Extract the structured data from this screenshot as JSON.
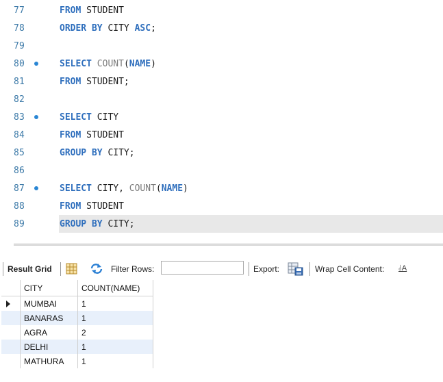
{
  "editor": {
    "lines": [
      {
        "number": "77",
        "marker": false,
        "tokens": [
          {
            "t": "kw",
            "v": "FROM "
          },
          {
            "t": "plain",
            "v": "STUDENT"
          }
        ]
      },
      {
        "number": "78",
        "marker": false,
        "tokens": [
          {
            "t": "kw",
            "v": "ORDER BY "
          },
          {
            "t": "plain",
            "v": "CITY "
          },
          {
            "t": "kw",
            "v": "ASC"
          },
          {
            "t": "plain",
            "v": ";"
          }
        ]
      },
      {
        "number": "79",
        "marker": false,
        "tokens": []
      },
      {
        "number": "80",
        "marker": true,
        "tokens": [
          {
            "t": "kw",
            "v": "SELECT "
          },
          {
            "t": "fn",
            "v": "COUNT"
          },
          {
            "t": "plain",
            "v": "("
          },
          {
            "t": "col",
            "v": "NAME"
          },
          {
            "t": "plain",
            "v": ")"
          }
        ]
      },
      {
        "number": "81",
        "marker": false,
        "tokens": [
          {
            "t": "kw",
            "v": "FROM "
          },
          {
            "t": "plain",
            "v": "STUDENT;"
          }
        ]
      },
      {
        "number": "82",
        "marker": false,
        "tokens": []
      },
      {
        "number": "83",
        "marker": true,
        "tokens": [
          {
            "t": "kw",
            "v": "SELECT "
          },
          {
            "t": "plain",
            "v": "CITY"
          }
        ]
      },
      {
        "number": "84",
        "marker": false,
        "tokens": [
          {
            "t": "kw",
            "v": "FROM "
          },
          {
            "t": "plain",
            "v": "STUDENT"
          }
        ]
      },
      {
        "number": "85",
        "marker": false,
        "tokens": [
          {
            "t": "kw",
            "v": "GROUP BY "
          },
          {
            "t": "plain",
            "v": "CITY;"
          }
        ]
      },
      {
        "number": "86",
        "marker": false,
        "tokens": []
      },
      {
        "number": "87",
        "marker": true,
        "tokens": [
          {
            "t": "kw",
            "v": "SELECT "
          },
          {
            "t": "plain",
            "v": "CITY, "
          },
          {
            "t": "fn",
            "v": "COUNT"
          },
          {
            "t": "plain",
            "v": "("
          },
          {
            "t": "col",
            "v": "NAME"
          },
          {
            "t": "plain",
            "v": ")"
          }
        ]
      },
      {
        "number": "88",
        "marker": false,
        "tokens": [
          {
            "t": "kw",
            "v": "FROM "
          },
          {
            "t": "plain",
            "v": "STUDENT"
          }
        ]
      },
      {
        "number": "89",
        "marker": false,
        "current": true,
        "tokens": [
          {
            "t": "kw",
            "v": "GROUP BY "
          },
          {
            "t": "plain",
            "v": "CITY;"
          }
        ]
      }
    ]
  },
  "toolbar": {
    "result_grid_label": "Result Grid",
    "filter_rows_label": "Filter Rows:",
    "filter_rows_value": "",
    "export_label": "Export:",
    "wrap_label": "Wrap Cell Content:",
    "wrap_icon_text": "⫰A"
  },
  "grid": {
    "columns": [
      "CITY",
      "COUNT(NAME)"
    ],
    "rows": [
      {
        "city": "MUMBAI",
        "count": "1",
        "selected": true
      },
      {
        "city": "BANARAS",
        "count": "1"
      },
      {
        "city": "AGRA",
        "count": "2"
      },
      {
        "city": "DELHI",
        "count": "1"
      },
      {
        "city": "MATHURA",
        "count": "1"
      }
    ]
  },
  "colors": {
    "keyword": "#2f6fbd",
    "line_number": "#3d7aa8",
    "marker": "#2a86d4",
    "alt_row": "#e8f0fb"
  }
}
